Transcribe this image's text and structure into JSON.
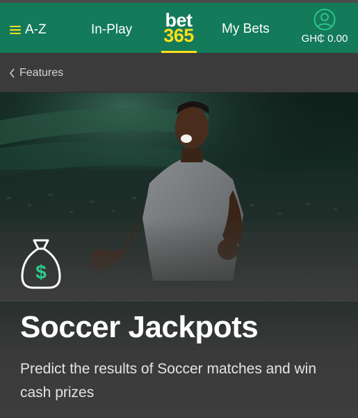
{
  "header": {
    "az_label": "A-Z",
    "inplay_label": "In-Play",
    "logo_top": "bet",
    "logo_bottom": "365",
    "mybets_label": "My Bets",
    "balance": "GH₵ 0.00"
  },
  "breadcrumb": {
    "back_label": "Features"
  },
  "hero": {
    "title": "Soccer Jackpots",
    "description": "Predict the results of Soccer matches and win cash prizes"
  },
  "icons": {
    "menu": "hamburger-icon",
    "back": "chevron-left-icon",
    "account": "user-circle-icon",
    "feature": "money-bag-icon"
  },
  "colors": {
    "header_bg": "#137a5a",
    "accent_yellow": "#ffdf1b",
    "icon_green": "#2ecc8f"
  }
}
